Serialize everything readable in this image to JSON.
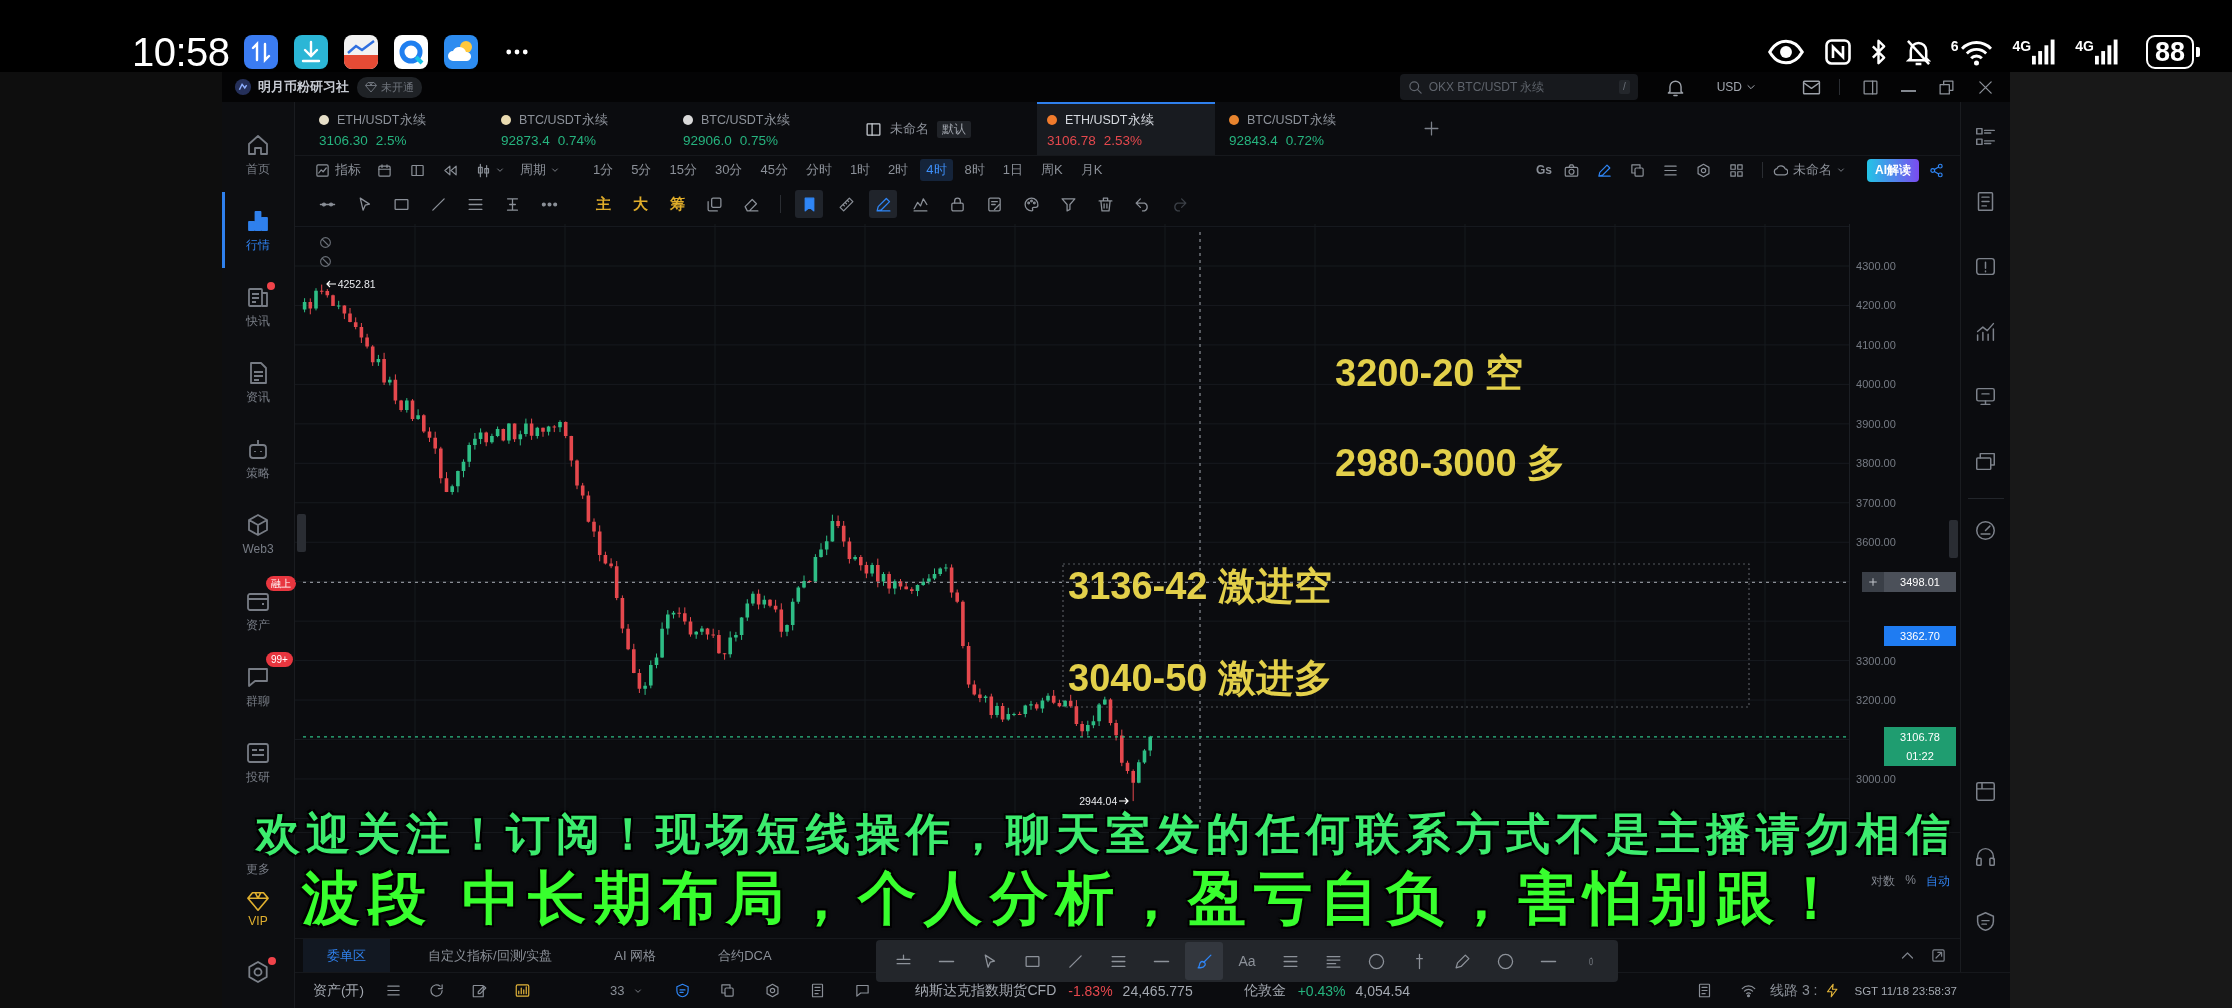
{
  "phone_status_bar": {
    "time": "10:58",
    "wifi_label": "6",
    "network_labels": [
      "4G",
      "4G"
    ],
    "battery": "88"
  },
  "title_bar": {
    "brand": "明月币粉研习社",
    "badge": "未开通",
    "search": {
      "placeholder": "OKX BTC/USDT 永续",
      "shortcut": "/"
    },
    "currency": "USD"
  },
  "nav": {
    "items": [
      {
        "kind": "house",
        "label": "首页",
        "selected": false,
        "unread": false
      },
      {
        "kind": "bars",
        "label": "行情",
        "selected": true,
        "unread": false
      },
      {
        "kind": "news",
        "label": "快讯",
        "selected": false,
        "unread": true
      },
      {
        "kind": "document",
        "label": "资讯",
        "selected": false,
        "unread": false
      },
      {
        "kind": "robot",
        "label": "策略",
        "selected": false,
        "unread": false
      },
      {
        "kind": "cube",
        "label": "Web3",
        "selected": false,
        "unread": false
      },
      {
        "kind": "wallet",
        "label": "资产",
        "badge": "融上",
        "selected": false,
        "unread": false
      },
      {
        "kind": "chat",
        "label": "群聊",
        "badge": "99+",
        "selected": false,
        "unread": false
      },
      {
        "kind": "qa",
        "label": "投研",
        "selected": false,
        "unread": false
      }
    ],
    "bottom_items": [
      {
        "kind": "more",
        "label": "更多",
        "selected": false
      },
      {
        "kind": "diamond",
        "label": "VIP",
        "selected": false
      }
    ],
    "settings": {
      "unread": true
    }
  },
  "tabs": [
    {
      "kind": "pair",
      "name": "ETH/USDT永续",
      "price": "3106.30",
      "change": "2.5%",
      "rising": true,
      "color": "#e6dfc8",
      "selected": false
    },
    {
      "kind": "pair",
      "name": "BTC/USDT永续",
      "price": "92873.4",
      "change": "0.74%",
      "rising": true,
      "color": "#eadbb0",
      "selected": false
    },
    {
      "kind": "pair",
      "name": "BTC/USDT永续",
      "price": "92906.0",
      "change": "0.75%",
      "rising": true,
      "color": "#d9d9d9",
      "selected": false
    },
    {
      "kind": "layout",
      "name": "未命名",
      "tag": "默认",
      "selected": false
    },
    {
      "kind": "pair",
      "name": "ETH/USDT永续",
      "price": "3106.78",
      "change": "2.53%",
      "rising": false,
      "color": "#f07b2c",
      "selected": true
    },
    {
      "kind": "pair",
      "name": "BTC/USDT永续",
      "price": "92843.4",
      "change": "0.72%",
      "rising": true,
      "color": "#e8842e",
      "selected": false
    }
  ],
  "toolbar": {
    "indicators_label": "指标",
    "period_label": "周期",
    "timeframes": [
      {
        "label": "1分",
        "selected": false
      },
      {
        "label": "5分",
        "selected": false
      },
      {
        "label": "15分",
        "selected": false
      },
      {
        "label": "30分",
        "selected": false
      },
      {
        "label": "45分",
        "selected": false
      },
      {
        "label": "分时",
        "selected": false
      },
      {
        "label": "1时",
        "selected": false
      },
      {
        "label": "2时",
        "selected": false
      },
      {
        "label": "4时",
        "selected": true
      },
      {
        "label": "8时",
        "selected": false
      },
      {
        "label": "1日",
        "selected": false
      },
      {
        "label": "周K",
        "selected": false
      },
      {
        "label": "月K",
        "selected": false
      }
    ],
    "speed_label": "Gs",
    "layout_name": "未命名",
    "ai_button": "AI解读"
  },
  "drawing_toolbar": {
    "toggles": [
      "主",
      "大",
      "筹"
    ],
    "tools": [
      {
        "kind": "bookmark",
        "selected": true,
        "disabled": false
      },
      {
        "kind": "ruler",
        "selected": false,
        "disabled": false
      },
      {
        "kind": "pen",
        "selected": true,
        "disabled": false
      },
      {
        "kind": "zigzag",
        "selected": false,
        "disabled": false
      },
      {
        "kind": "lock",
        "selected": false,
        "disabled": false
      },
      {
        "kind": "note",
        "selected": false,
        "disabled": false
      },
      {
        "kind": "palette",
        "selected": false,
        "disabled": false
      },
      {
        "kind": "filter",
        "selected": false,
        "disabled": false
      },
      {
        "kind": "trash",
        "selected": false,
        "disabled": false
      },
      {
        "kind": "undo",
        "selected": false,
        "disabled": false
      },
      {
        "kind": "redo",
        "selected": false,
        "disabled": true
      }
    ]
  },
  "chart": {
    "high_label": "4252.81",
    "low_label": "2944.04",
    "price_ticks": [
      "4300.00",
      "4200.00",
      "4100.00",
      "4000.00",
      "3900.00",
      "3800.00",
      "3700.00",
      "3600.00",
      "3300.00",
      "3200.00",
      "3000.00"
    ],
    "crosshair_price": "3498.01",
    "line_price": "3362.70",
    "last_price": "3106.78",
    "countdown": "01:22",
    "annotations": [
      "3200-20 空",
      "2980-3000 多",
      "3136-42 激进空",
      "3040-50 激进多"
    ]
  },
  "bottom_panel": {
    "scale_options": [
      {
        "label": "对数",
        "selected": false
      },
      {
        "label": "%",
        "selected": false
      },
      {
        "label": "自动",
        "selected": true
      }
    ]
  },
  "bottom_tabs": [
    {
      "label": "委单区",
      "selected": true
    },
    {
      "label": "自定义指标/回测/实盘",
      "selected": false
    },
    {
      "label": "AI 网格",
      "selected": false
    },
    {
      "label": "合约DCA",
      "selected": false
    }
  ],
  "floating_toolbar": {
    "tools": [
      {
        "kind": "two-lines",
        "selected": false
      },
      {
        "kind": "dash",
        "selected": false
      },
      {
        "kind": "cursor",
        "selected": false
      },
      {
        "kind": "rectangle",
        "selected": false
      },
      {
        "kind": "diagonal-line",
        "selected": false
      },
      {
        "kind": "three-lines",
        "selected": false
      },
      {
        "kind": "dash",
        "selected": false
      },
      {
        "kind": "brush",
        "selected": true
      },
      {
        "kind": "text",
        "label": "Aa",
        "selected": false
      },
      {
        "kind": "menu",
        "selected": false
      },
      {
        "kind": "list",
        "selected": false
      },
      {
        "kind": "circle",
        "selected": false
      },
      {
        "kind": "vertical-line",
        "selected": false
      },
      {
        "kind": "pencil",
        "selected": false
      },
      {
        "kind": "circle",
        "selected": false
      },
      {
        "kind": "dash",
        "selected": false
      },
      {
        "kind": "grip",
        "selected": false
      }
    ]
  },
  "status_bar": {
    "account": "资产(开)",
    "leverage": "33",
    "tickers": [
      {
        "name": "纳斯达克指数期货CFD",
        "change": "-1.83%",
        "rising": false,
        "price": "24,465.775"
      },
      {
        "name": "伦敦金",
        "change": "+0.43%",
        "rising": true,
        "price": "4,054.54"
      }
    ],
    "route": "线路 3 :",
    "clock": "SGT 11/18 23:58:37"
  },
  "captions": [
    "欢迎关注！订阅！现场短线操作，聊天室发的任何联系方式不是主播请勿相信",
    "波段 中长期布局，个人分析，盈亏自负，害怕别跟！"
  ]
}
